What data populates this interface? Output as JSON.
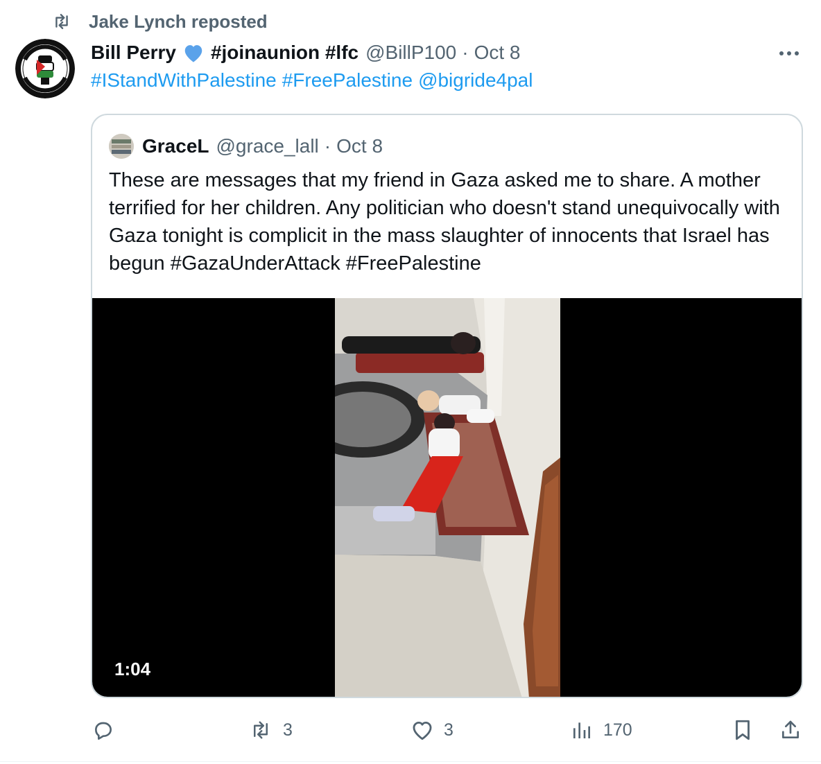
{
  "repost": {
    "icon": "repost-icon",
    "text": "Jake Lynch reposted"
  },
  "author": {
    "avatar_icon": "free-palestine-fist-logo",
    "name": "Bill Perry",
    "heart_icon": "blue-heart-icon",
    "hashtags_in_name": "#joinaunion #lfc",
    "handle": "@BillP100",
    "separator": "·",
    "date": "Oct 8"
  },
  "more_icon": "more-options-icon",
  "post_text": {
    "tag1": "#IStandWithPalestine",
    "tag2": "#FreePalestine",
    "mention": "@bigride4pal"
  },
  "quoted": {
    "name": "GraceL",
    "handle": "@grace_lall",
    "separator": "·",
    "date": "Oct 8",
    "text": "These are messages that my friend in Gaza asked me to share. A mother terrified for her children. Any politician who doesn't stand unequivocally with Gaza tonight is complicit in the mass slaughter of innocents that Israel has begun #GazaUnderAttack #FreePalestine",
    "video_duration": "1:04"
  },
  "actions": {
    "reply": {
      "icon": "reply-icon",
      "count": ""
    },
    "repost": {
      "icon": "repost-icon",
      "count": "3"
    },
    "like": {
      "icon": "heart-icon",
      "count": "3"
    },
    "views": {
      "icon": "views-icon",
      "count": "170"
    },
    "bookmark": {
      "icon": "bookmark-icon"
    },
    "share": {
      "icon": "share-icon"
    }
  },
  "colors": {
    "accent": "#1d9bf0",
    "muted": "#536471",
    "border": "#cfd9de"
  }
}
